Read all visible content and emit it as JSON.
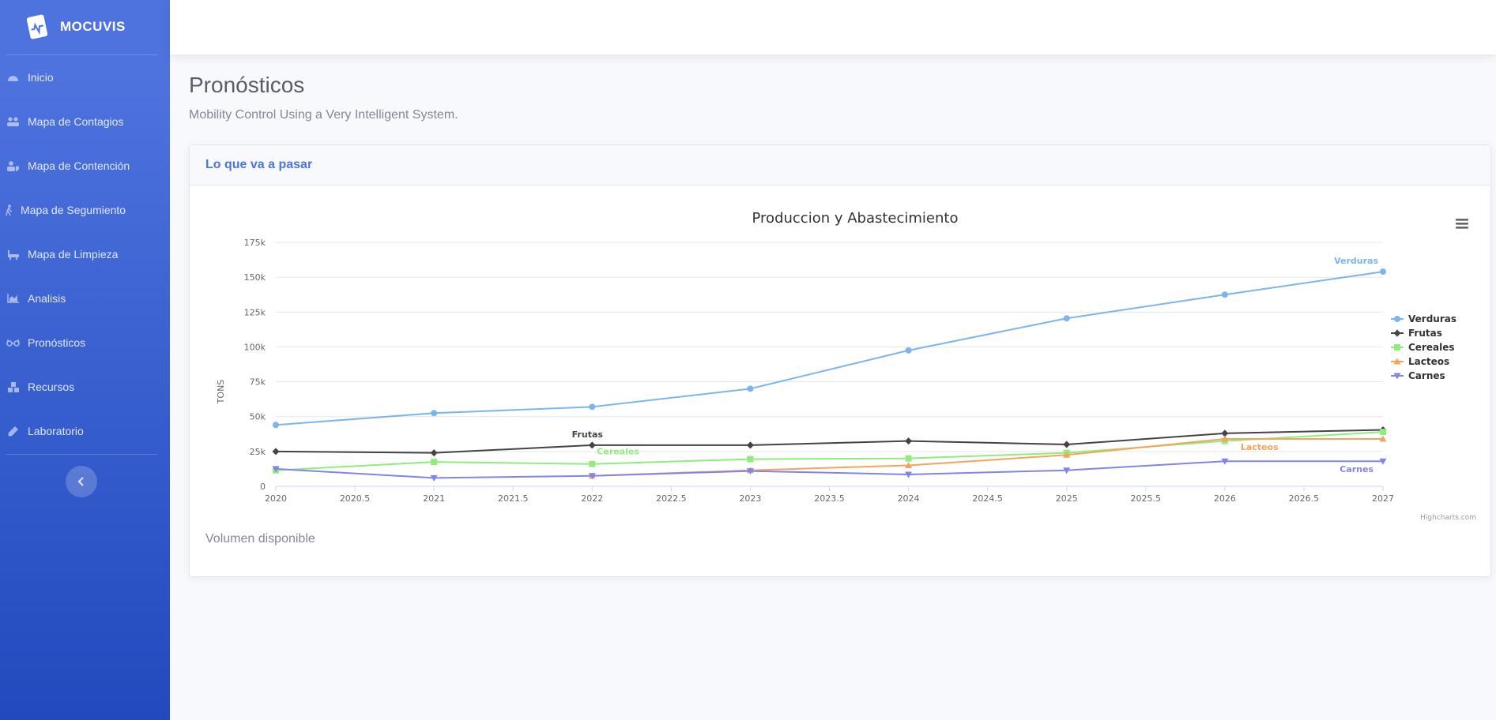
{
  "brand": {
    "name": "MOCUVIS"
  },
  "sidebar": {
    "items": [
      {
        "label": "Inicio",
        "icon": "dashboard-icon"
      },
      {
        "label": "Mapa de Contagios",
        "icon": "users-icon"
      },
      {
        "label": "Mapa de Contención",
        "icon": "user-shield-icon"
      },
      {
        "label": "Mapa de Segumiento",
        "icon": "walking-icon"
      },
      {
        "label": "Mapa de Limpieza",
        "icon": "bath-icon"
      },
      {
        "label": "Analisis",
        "icon": "chart-area-icon"
      },
      {
        "label": "Pronósticos",
        "icon": "glasses-icon"
      },
      {
        "label": "Recursos",
        "icon": "cubes-icon"
      },
      {
        "label": "Laboratorio",
        "icon": "flask-icon"
      }
    ]
  },
  "page": {
    "title": "Pronósticos",
    "subtitle": "Mobility Control Using a Very Intelligent System."
  },
  "card": {
    "title": "Lo que va a pasar",
    "footer": "Volumen disponible"
  },
  "chart_data": {
    "type": "line",
    "title": "Produccion y Abastecimiento",
    "xlabel": "",
    "ylabel": "TONS",
    "credits": "Highcharts.com",
    "xlim": [
      2020,
      2027
    ],
    "ylim": [
      0,
      175000
    ],
    "x_ticks": [
      "2020",
      "2020.5",
      "2021",
      "2021.5",
      "2022",
      "2022.5",
      "2023",
      "2023.5",
      "2024",
      "2024.5",
      "2025",
      "2025.5",
      "2026",
      "2026.5",
      "2027"
    ],
    "y_ticks": [
      "0",
      "25k",
      "50k",
      "75k",
      "100k",
      "125k",
      "150k",
      "175k"
    ],
    "legend_position": "right",
    "grid": true,
    "x": [
      2020,
      2021,
      2022,
      2023,
      2024,
      2025,
      2026,
      2027
    ],
    "series": [
      {
        "name": "Verduras",
        "color": "#7cb5ec",
        "marker": "circle",
        "values": [
          44000,
          52500,
          57000,
          70000,
          97500,
          120500,
          137500,
          154000
        ]
      },
      {
        "name": "Frutas",
        "color": "#434348",
        "marker": "diamond",
        "values": [
          25000,
          24000,
          29500,
          29500,
          32500,
          30000,
          38000,
          40500
        ]
      },
      {
        "name": "Cereales",
        "color": "#90ed7d",
        "marker": "square",
        "values": [
          11500,
          17500,
          16000,
          19500,
          20000,
          24000,
          32500,
          39000
        ]
      },
      {
        "name": "Lacteos",
        "color": "#f7a35c",
        "marker": "triangle",
        "values": [
          null,
          null,
          7500,
          11500,
          15000,
          22500,
          34000,
          34000
        ]
      },
      {
        "name": "Carnes",
        "color": "#8085e9",
        "marker": "triangle-down",
        "values": [
          12500,
          6000,
          7500,
          11000,
          8500,
          11500,
          18000,
          18000
        ]
      }
    ]
  }
}
